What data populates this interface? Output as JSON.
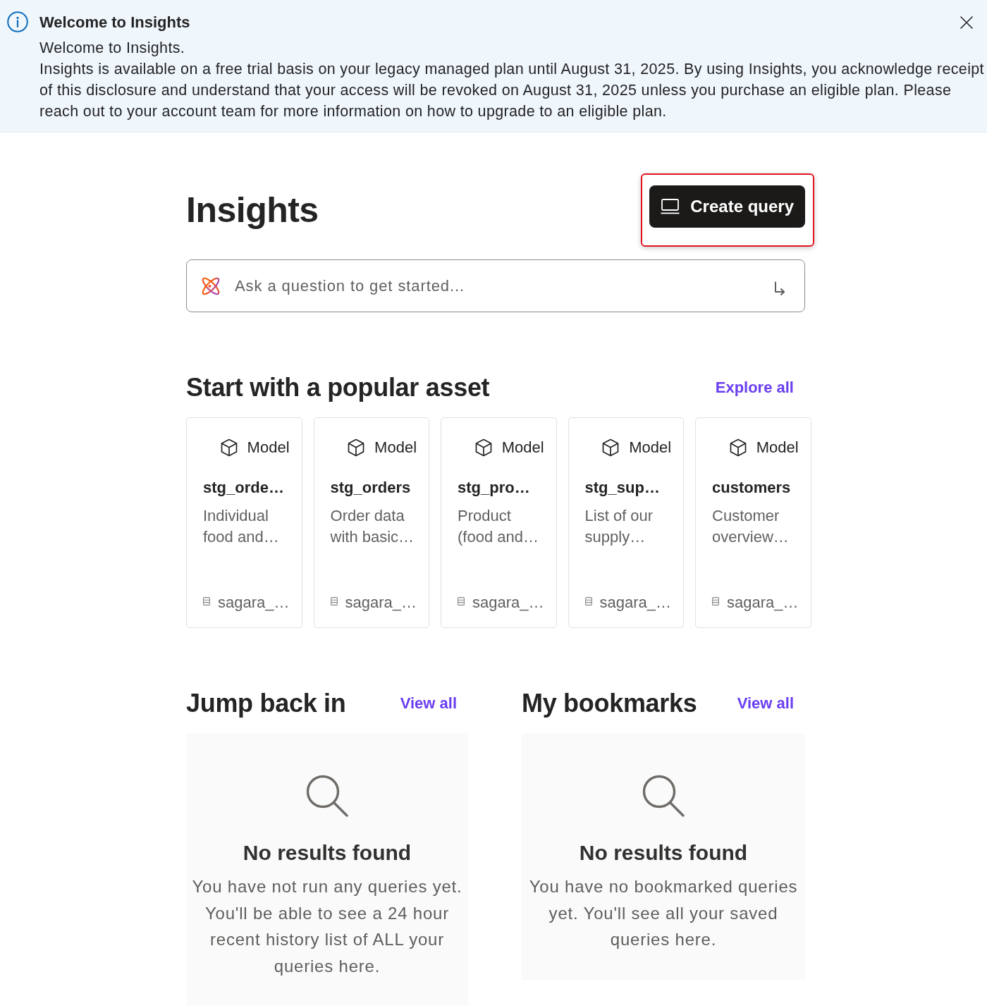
{
  "banner": {
    "title": "Welcome to Insights",
    "message": [
      "Welcome to Insights.",
      "Insights is available on a free trial basis on your legacy managed plan until August 31, 2025. By using Insights, you acknowledge receipt of this disclosure and understand that your access will be revoked on August 31, 2025 unless you purchase an eligible plan. Please reach out to your account team for more information on how to upgrade to an eligible plan."
    ]
  },
  "header": {
    "title": "Insights",
    "create_query": {
      "label": "Create query",
      "highlighted": true
    }
  },
  "ask_field": {
    "placeholder": "Ask a question to get started..."
  },
  "popular_assets": {
    "title": "Start with a popular asset",
    "link": "Explore all",
    "cards": [
      {
        "type": "Model",
        "name": "stg_orde…",
        "description": "Individual food and…",
        "source": "sagara_…"
      },
      {
        "type": "Model",
        "name": "stg_orders",
        "description": "Order data with basic…",
        "source": "sagara_…"
      },
      {
        "type": "Model",
        "name": "stg_pro…",
        "description": "Product (food and…",
        "source": "sagara_…"
      },
      {
        "type": "Model",
        "name": "stg_sup…",
        "description": "List of our supply…",
        "source": "sagara_…"
      },
      {
        "type": "Model",
        "name": "customers",
        "description": "Customer overview…",
        "source": "sagara_…"
      }
    ]
  },
  "sections": [
    {
      "title": "Jump back in",
      "link": "View all",
      "empty": {
        "title": "No results found",
        "message": "You have not run any queries yet. You'll be able to see a 24 hour recent history list of ALL your queries here."
      }
    },
    {
      "title": "My bookmarks",
      "link": "View all",
      "empty": {
        "title": "No results found",
        "message": "You have no bookmarked queries yet. You'll see all your saved queries here."
      }
    }
  ]
}
